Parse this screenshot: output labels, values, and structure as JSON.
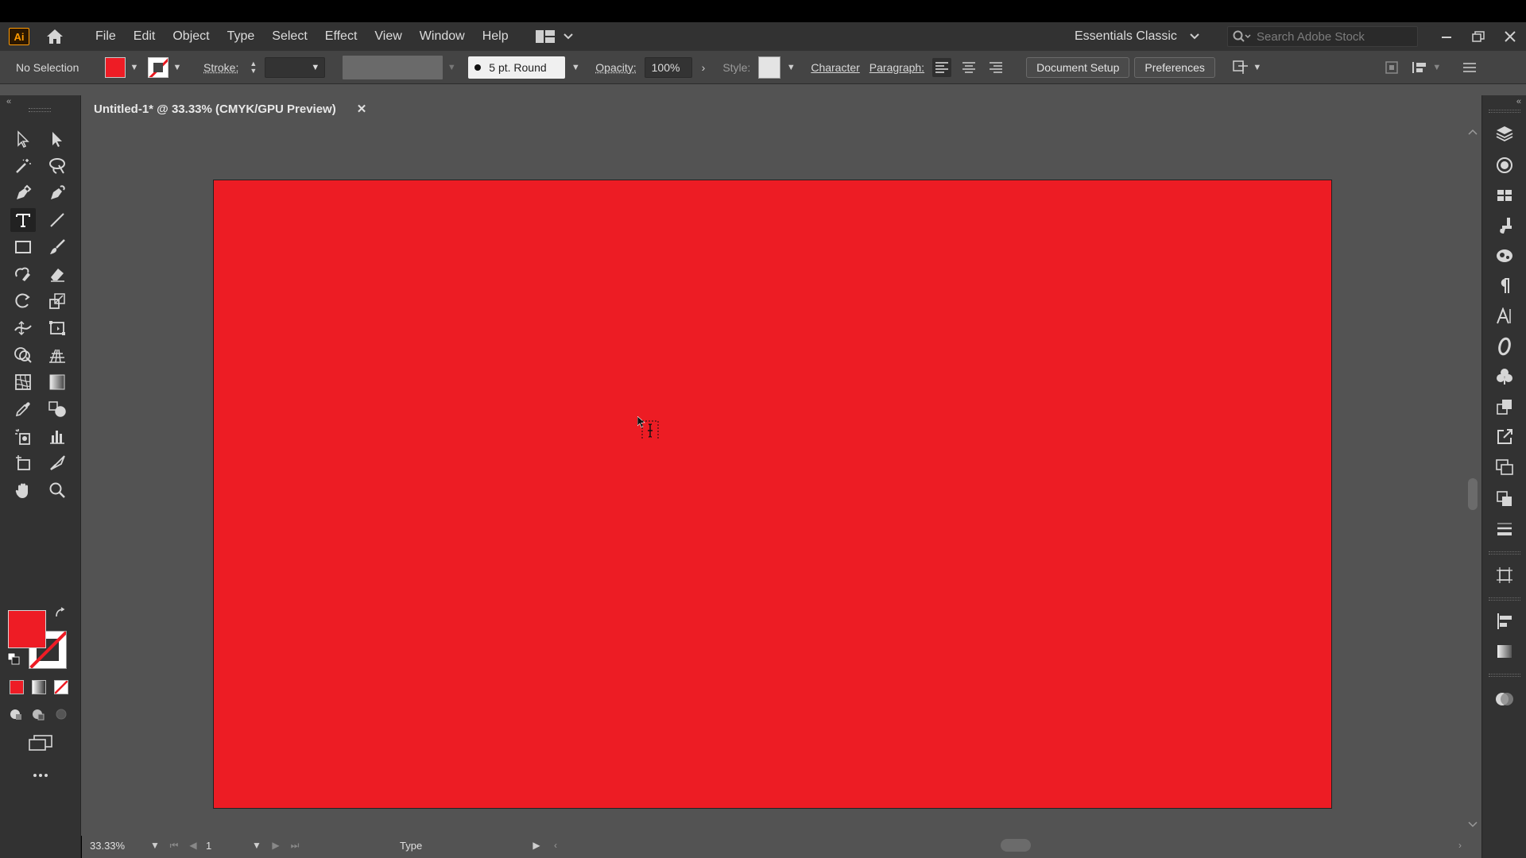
{
  "app": {
    "logo": "Ai",
    "menu": [
      "File",
      "Edit",
      "Object",
      "Type",
      "Select",
      "Effect",
      "View",
      "Window",
      "Help"
    ],
    "workspace": "Essentials Classic",
    "search_placeholder": "Search Adobe Stock"
  },
  "control_bar": {
    "selection": "No Selection",
    "stroke_label": "Stroke:",
    "brush": "5 pt. Round",
    "opacity_label": "Opacity:",
    "opacity_value": "100%",
    "style_label": "Style:",
    "character": "Character",
    "paragraph": "Paragraph:",
    "document_setup": "Document Setup",
    "preferences": "Preferences"
  },
  "document": {
    "tab_title": "Untitled-1* @ 33.33% (CMYK/GPU Preview)",
    "artboard_color": "#ed1c24"
  },
  "colors": {
    "fill": "#ee1c25",
    "stroke": "none"
  },
  "status_bar": {
    "zoom": "33.33%",
    "artboard_number": "1",
    "current_tool": "Type"
  },
  "tools": {
    "active": "type-tool"
  }
}
